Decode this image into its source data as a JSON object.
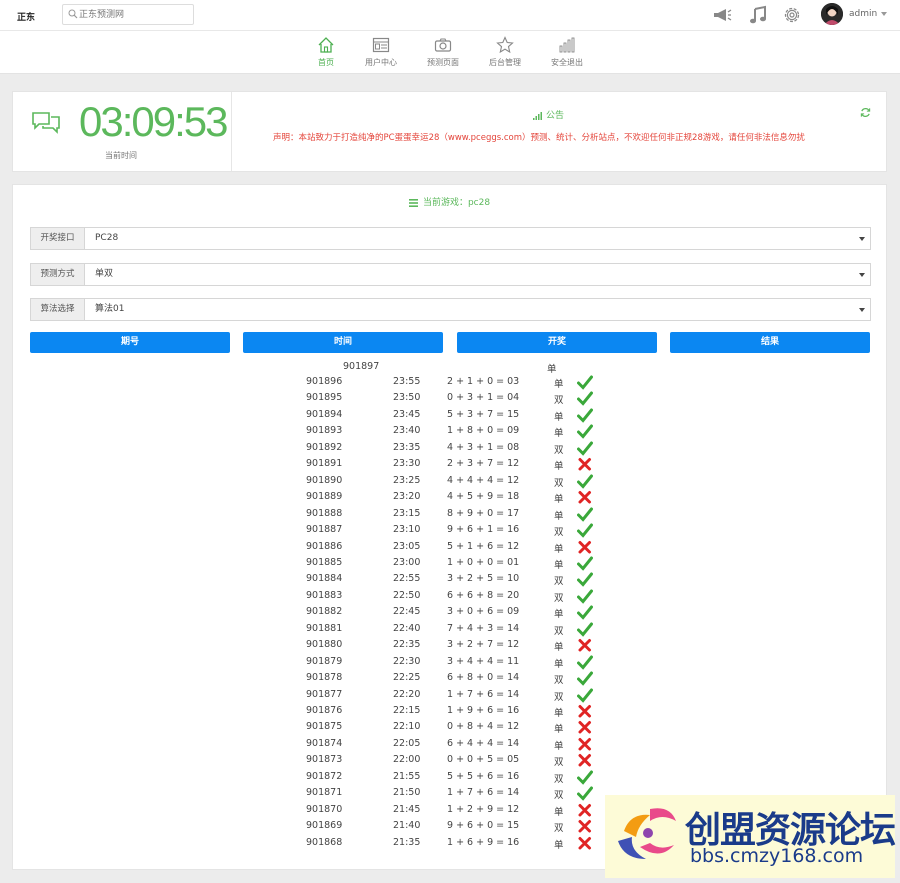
{
  "topbar": {
    "brand": "正东",
    "search_placeholder": "正东预测网",
    "user": "admin"
  },
  "nav": {
    "items": [
      {
        "label": "首页",
        "icon": "home-icon",
        "active": true
      },
      {
        "label": "用户中心",
        "icon": "user-card-icon",
        "active": false
      },
      {
        "label": "预测页面",
        "icon": "camera-icon",
        "active": false
      },
      {
        "label": "后台管理",
        "icon": "star-icon",
        "active": false
      },
      {
        "label": "安全退出",
        "icon": "bar-chart-icon",
        "active": false
      }
    ]
  },
  "clock": {
    "time": "03:09:53",
    "label": "当前时间"
  },
  "notice": {
    "title": "公告",
    "text": "声明：本站致力于打造纯净的PC蛋蛋幸运28（www.pceggs.com）预测、统计、分析站点，不欢迎任何非正规28游戏，请任何非法信息勿扰"
  },
  "game": {
    "title": "当前游戏：pc28"
  },
  "filters": [
    {
      "label": "开奖接口",
      "value": "PC28"
    },
    {
      "label": "预测方式",
      "value": "单双"
    },
    {
      "label": "算法选择",
      "value": "算法01"
    }
  ],
  "table": {
    "headers": [
      "期号",
      "时间",
      "开奖",
      "结果"
    ],
    "current": {
      "issue": "901897",
      "prediction": "单"
    },
    "rows": [
      {
        "id": "901896",
        "time": "23:55",
        "expr": "2 + 1 + 0 = 03",
        "pred": "单",
        "ok": true
      },
      {
        "id": "901895",
        "time": "23:50",
        "expr": "0 + 3 + 1 = 04",
        "pred": "双",
        "ok": true
      },
      {
        "id": "901894",
        "time": "23:45",
        "expr": "5 + 3 + 7 = 15",
        "pred": "单",
        "ok": true
      },
      {
        "id": "901893",
        "time": "23:40",
        "expr": "1 + 8 + 0 = 09",
        "pred": "单",
        "ok": true
      },
      {
        "id": "901892",
        "time": "23:35",
        "expr": "4 + 3 + 1 = 08",
        "pred": "双",
        "ok": true
      },
      {
        "id": "901891",
        "time": "23:30",
        "expr": "2 + 3 + 7 = 12",
        "pred": "单",
        "ok": false
      },
      {
        "id": "901890",
        "time": "23:25",
        "expr": "4 + 4 + 4 = 12",
        "pred": "双",
        "ok": true
      },
      {
        "id": "901889",
        "time": "23:20",
        "expr": "4 + 5 + 9 = 18",
        "pred": "单",
        "ok": false
      },
      {
        "id": "901888",
        "time": "23:15",
        "expr": "8 + 9 + 0 = 17",
        "pred": "单",
        "ok": true
      },
      {
        "id": "901887",
        "time": "23:10",
        "expr": "9 + 6 + 1 = 16",
        "pred": "双",
        "ok": true
      },
      {
        "id": "901886",
        "time": "23:05",
        "expr": "5 + 1 + 6 = 12",
        "pred": "单",
        "ok": false
      },
      {
        "id": "901885",
        "time": "23:00",
        "expr": "1 + 0 + 0 = 01",
        "pred": "单",
        "ok": true
      },
      {
        "id": "901884",
        "time": "22:55",
        "expr": "3 + 2 + 5 = 10",
        "pred": "双",
        "ok": true
      },
      {
        "id": "901883",
        "time": "22:50",
        "expr": "6 + 6 + 8 = 20",
        "pred": "双",
        "ok": true
      },
      {
        "id": "901882",
        "time": "22:45",
        "expr": "3 + 0 + 6 = 09",
        "pred": "单",
        "ok": true
      },
      {
        "id": "901881",
        "time": "22:40",
        "expr": "7 + 4 + 3 = 14",
        "pred": "双",
        "ok": true
      },
      {
        "id": "901880",
        "time": "22:35",
        "expr": "3 + 2 + 7 = 12",
        "pred": "单",
        "ok": false
      },
      {
        "id": "901879",
        "time": "22:30",
        "expr": "3 + 4 + 4 = 11",
        "pred": "单",
        "ok": true
      },
      {
        "id": "901878",
        "time": "22:25",
        "expr": "6 + 8 + 0 = 14",
        "pred": "双",
        "ok": true
      },
      {
        "id": "901877",
        "time": "22:20",
        "expr": "1 + 7 + 6 = 14",
        "pred": "双",
        "ok": true
      },
      {
        "id": "901876",
        "time": "22:15",
        "expr": "1 + 9 + 6 = 16",
        "pred": "单",
        "ok": false
      },
      {
        "id": "901875",
        "time": "22:10",
        "expr": "0 + 8 + 4 = 12",
        "pred": "单",
        "ok": false
      },
      {
        "id": "901874",
        "time": "22:05",
        "expr": "6 + 4 + 4 = 14",
        "pred": "单",
        "ok": false
      },
      {
        "id": "901873",
        "time": "22:00",
        "expr": "0 + 0 + 5 = 05",
        "pred": "双",
        "ok": false
      },
      {
        "id": "901872",
        "time": "21:55",
        "expr": "5 + 5 + 6 = 16",
        "pred": "双",
        "ok": true
      },
      {
        "id": "901871",
        "time": "21:50",
        "expr": "1 + 7 + 6 = 14",
        "pred": "双",
        "ok": true
      },
      {
        "id": "901870",
        "time": "21:45",
        "expr": "1 + 2 + 9 = 12",
        "pred": "单",
        "ok": false
      },
      {
        "id": "901869",
        "time": "21:40",
        "expr": "9 + 6 + 0 = 15",
        "pred": "双",
        "ok": false
      },
      {
        "id": "901868",
        "time": "21:35",
        "expr": "1 + 6 + 9 = 16",
        "pred": "单",
        "ok": false
      }
    ]
  },
  "watermark": {
    "title": "创盟资源论坛",
    "url": "bbs.cmzy168.com"
  },
  "colors": {
    "accent_green": "#5cb85c",
    "notice_red": "#e4453b",
    "header_blue": "#0b87f2",
    "check_green": "#3aa83a",
    "cross_red": "#e02424"
  }
}
